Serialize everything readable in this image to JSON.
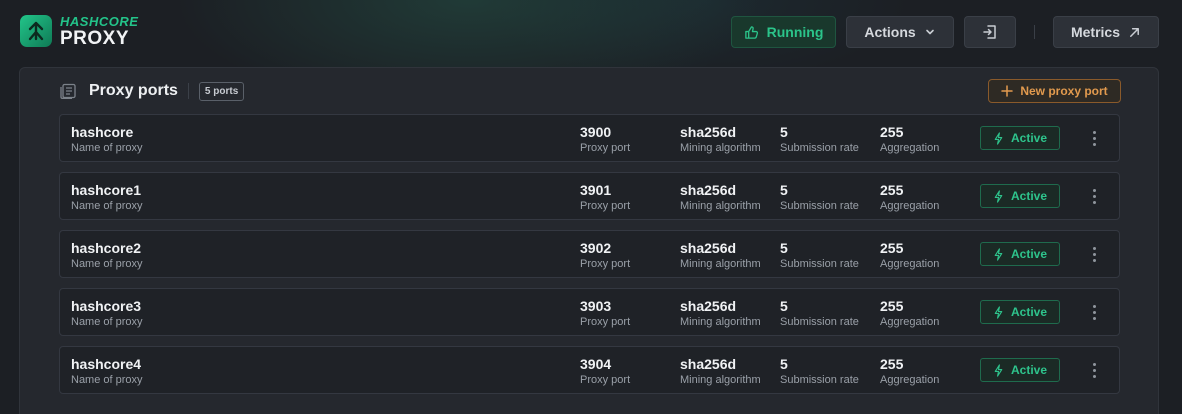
{
  "brand": {
    "top": "HASHCORE",
    "bottom": "PROXY"
  },
  "header": {
    "running_label": "Running",
    "actions_label": "Actions",
    "metrics_label": "Metrics"
  },
  "panel": {
    "title": "Proxy ports",
    "badge": "5 ports",
    "new_button_label": "New proxy port"
  },
  "colors": {
    "accent_green": "#2bc48a",
    "accent_orange": "#e29a4e",
    "background": "#1c1f24"
  },
  "icons": {
    "logo": "hashcore-logo-icon",
    "running": "thumbs-up-icon",
    "actions": "chevron-down-icon",
    "logout": "logout-icon",
    "metrics": "arrow-up-right-icon",
    "panel": "server-list-icon",
    "new": "plus-icon",
    "active": "bolt-icon",
    "menu": "kebab-menu-icon"
  },
  "labels": {
    "name": "Name of proxy",
    "port": "Proxy port",
    "algorithm": "Mining algorithm",
    "rate": "Submission rate",
    "aggregation": "Aggregation",
    "status": "Active"
  },
  "proxies": [
    {
      "name": "hashcore",
      "port": "3900",
      "algorithm": "sha256d",
      "rate": "5",
      "aggregation": "255",
      "status": "Active"
    },
    {
      "name": "hashcore1",
      "port": "3901",
      "algorithm": "sha256d",
      "rate": "5",
      "aggregation": "255",
      "status": "Active"
    },
    {
      "name": "hashcore2",
      "port": "3902",
      "algorithm": "sha256d",
      "rate": "5",
      "aggregation": "255",
      "status": "Active"
    },
    {
      "name": "hashcore3",
      "port": "3903",
      "algorithm": "sha256d",
      "rate": "5",
      "aggregation": "255",
      "status": "Active"
    },
    {
      "name": "hashcore4",
      "port": "3904",
      "algorithm": "sha256d",
      "rate": "5",
      "aggregation": "255",
      "status": "Active"
    }
  ]
}
